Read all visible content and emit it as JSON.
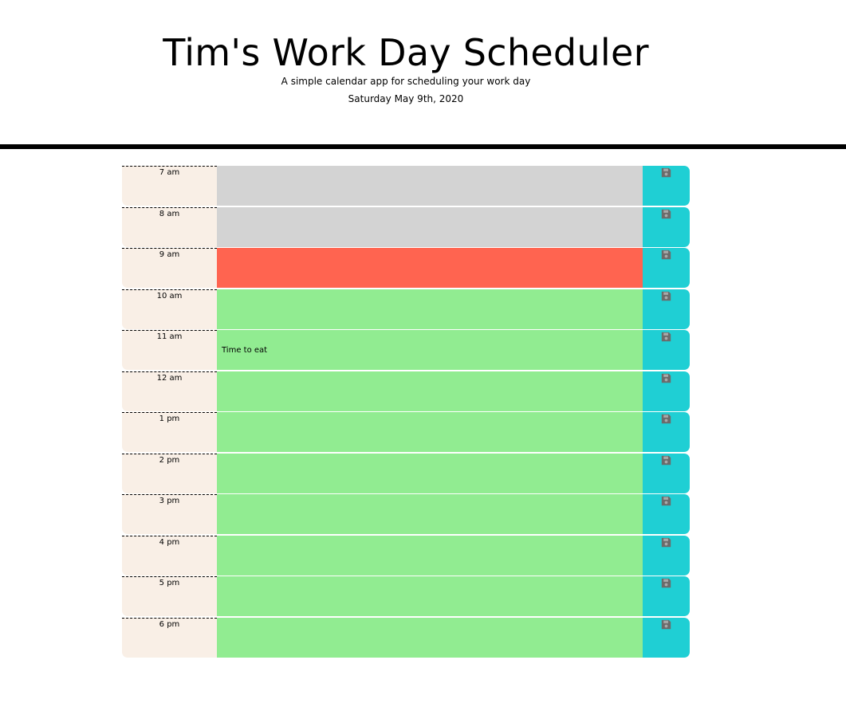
{
  "header": {
    "title": "Tim's Work Day Scheduler",
    "subtitle": "A simple calendar app for scheduling your work day",
    "current_day": "Saturday May 9th, 2020"
  },
  "colors": {
    "past": "#d3d3d3",
    "present": "#ff6450",
    "future": "#91ec91",
    "hour_bg": "#f9efe6",
    "save_bg": "#1fcfd4",
    "save_icon": "#6b6b6b"
  },
  "icons": {
    "save": "floppy-disk-icon"
  },
  "time_blocks": [
    {
      "hour": "7 am",
      "text": "",
      "status": "past"
    },
    {
      "hour": "8 am",
      "text": "",
      "status": "past"
    },
    {
      "hour": "9 am",
      "text": "",
      "status": "present"
    },
    {
      "hour": "10 am",
      "text": "",
      "status": "future"
    },
    {
      "hour": "11 am",
      "text": "Time to eat",
      "status": "future"
    },
    {
      "hour": "12 am",
      "text": "",
      "status": "future"
    },
    {
      "hour": "1 pm",
      "text": "",
      "status": "future"
    },
    {
      "hour": "2 pm",
      "text": "",
      "status": "future"
    },
    {
      "hour": "3 pm",
      "text": "",
      "status": "future"
    },
    {
      "hour": "4 pm",
      "text": "",
      "status": "future"
    },
    {
      "hour": "5 pm",
      "text": "",
      "status": "future"
    },
    {
      "hour": "6 pm",
      "text": "",
      "status": "future"
    }
  ]
}
